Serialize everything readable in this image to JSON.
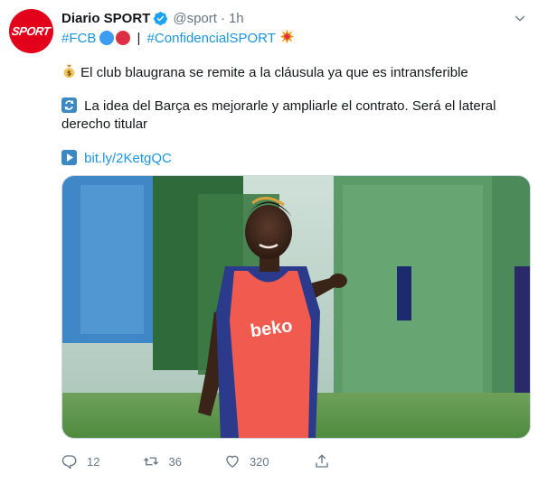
{
  "account": {
    "avatar_text": "SPORT",
    "name": "Diario SPORT",
    "handle": "@sport",
    "separator": "·",
    "time": "1h",
    "verified_icon": "verified-badge-icon"
  },
  "tweet": {
    "hashtag_fcb": "#FCB",
    "divider": "|",
    "hashtag_confidencial": "#ConfidencialSPORT",
    "line1_emoji": "money-bag-icon",
    "line1_text": "El club blaugrana se remite a la cláusula ya que es intransferible",
    "line2_emoji": "repeat-arrows-icon",
    "line2_text_a": "La idea del Barça es mejorarle y ampliarle el contrato. Será el lateral",
    "line2_text_b": "derecho titular",
    "link_emoji": "play-button-icon",
    "link": "bit.ly/2KetgQC"
  },
  "media": {
    "type": "photo",
    "bib_text": "beko"
  },
  "actions": {
    "replies": "12",
    "retweets": "36",
    "likes": "320"
  },
  "colors": {
    "link": "#1b95e0",
    "brand_red": "#e2001a",
    "verified": "#1da1f2",
    "muted": "#657786",
    "bib": "#f15a4f"
  }
}
